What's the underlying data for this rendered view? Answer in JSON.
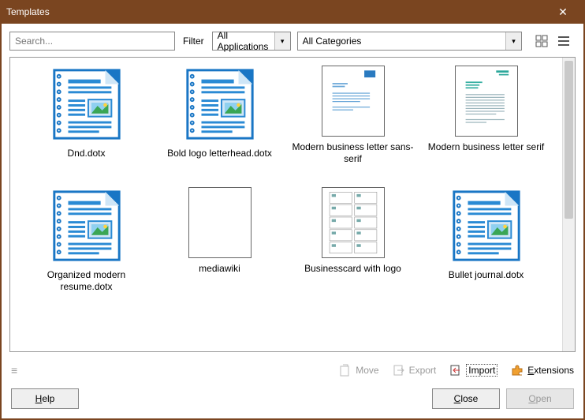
{
  "window": {
    "title": "Templates",
    "close": "✕"
  },
  "toolbar": {
    "search_placeholder": "Search...",
    "filter_label": "Filter",
    "app_combo": "All Applications",
    "cat_combo": "All Categories"
  },
  "items": [
    {
      "label": "Dnd.dotx",
      "kind": "doc-icon"
    },
    {
      "label": "Bold logo letterhead.dotx",
      "kind": "doc-icon"
    },
    {
      "label": "Modern business letter sans-serif",
      "kind": "letter-blue"
    },
    {
      "label": "Modern business letter serif",
      "kind": "letter-teal"
    },
    {
      "label": "Organized modern resume.dotx",
      "kind": "doc-icon"
    },
    {
      "label": "mediawiki",
      "kind": "blank"
    },
    {
      "label": "Businesscard with logo",
      "kind": "cards"
    },
    {
      "label": "Bullet journal.dotx",
      "kind": "doc-icon"
    }
  ],
  "actions": {
    "move": "Move",
    "export": "Export",
    "import": "Import",
    "extensions": "Extensions"
  },
  "buttons": {
    "help": "Help",
    "close": "Close",
    "open": "Open"
  }
}
